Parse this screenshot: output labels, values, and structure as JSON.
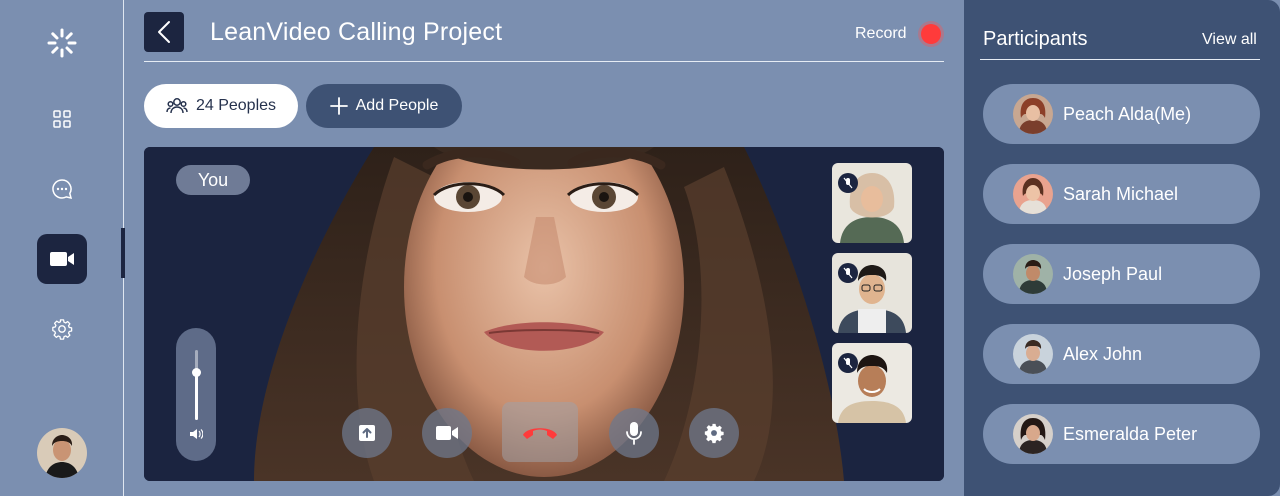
{
  "header": {
    "title": "LeanVideo Calling Project",
    "record_label": "Record",
    "record_color": "#ff3b3b"
  },
  "toolbar": {
    "peoples_label": "24 Peoples",
    "add_people_label": "Add People"
  },
  "sidebar": {
    "items": [
      {
        "icon": "grid-icon"
      },
      {
        "icon": "chat-icon"
      },
      {
        "icon": "video-camera-icon",
        "active": true
      },
      {
        "icon": "gear-icon"
      }
    ]
  },
  "stage": {
    "you_label": "You",
    "volume_level": 0.68,
    "controls": [
      {
        "icon": "share-screen-icon"
      },
      {
        "icon": "video-camera-icon"
      },
      {
        "icon": "end-call-icon"
      },
      {
        "icon": "microphone-icon"
      },
      {
        "icon": "gear-icon"
      }
    ],
    "thumbnails": [
      {
        "muted": true
      },
      {
        "muted": true
      },
      {
        "muted": true
      }
    ]
  },
  "participants": {
    "title": "Participants",
    "view_all": "View all",
    "items": [
      {
        "name": "Peach Alda(Me)"
      },
      {
        "name": "Sarah Michael"
      },
      {
        "name": "Joseph Paul"
      },
      {
        "name": "Alex John"
      },
      {
        "name": "Esmeralda Peter"
      }
    ]
  },
  "colors": {
    "background": "#7b8fb0",
    "dark_navy": "#1c2540",
    "panel": "#3e5274",
    "end_call": "#ff3b3b"
  }
}
